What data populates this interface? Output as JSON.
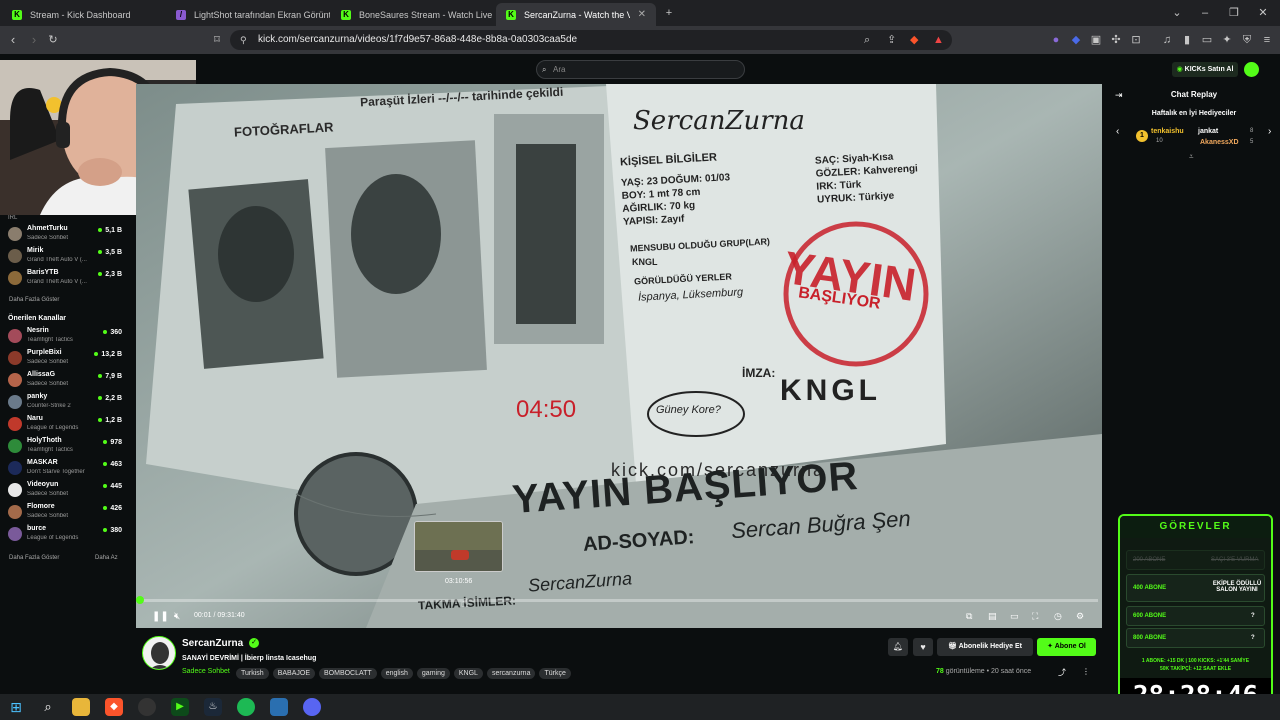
{
  "tabs": [
    {
      "label": "Stream - Kick Dashboard"
    },
    {
      "label": "LightShot tarafından Ekran Görüntüsü"
    },
    {
      "label": "BoneSaures Stream - Watch Live on Kick"
    },
    {
      "label": "SercanZurna - Watch the VOD on Kick"
    }
  ],
  "address": {
    "url": "kick.com/sercanzurna/videos/1f7d9e57-86a8-448e-8b8a-0a0303caa5de"
  },
  "topbar": {
    "search_placeholder": "Ara",
    "kicks_button": "KICKs Satın Al"
  },
  "sidebar": {
    "irl_label": "IRL",
    "followed": [
      {
        "name": "AhmetTurku",
        "game": "Sadece Sohbet",
        "viewers": "5,1 B",
        "color": "#8a7d6d"
      },
      {
        "name": "Mirik",
        "game": "Grand Theft Auto V (...",
        "viewers": "3,5 B",
        "color": "#6b5d4a"
      },
      {
        "name": "BarisYTB",
        "game": "Grand Theft Auto V (...",
        "viewers": "2,3 B",
        "color": "#8c6a3a"
      }
    ],
    "show_more": "Daha Fazla Göster",
    "recommended_title": "Önerilen Kanallar",
    "recommended": [
      {
        "name": "Nesrin",
        "game": "Teamfight Tactics",
        "viewers": "360",
        "color": "#a34b5a"
      },
      {
        "name": "PurpleBixi",
        "game": "Sadece Sohbet",
        "viewers": "13,2 B",
        "color": "#8b3a2a"
      },
      {
        "name": "AllissaG",
        "game": "Sadece Sohbet",
        "viewers": "7,9 B",
        "color": "#b5644a"
      },
      {
        "name": "panky",
        "game": "Counter-Strike 2",
        "viewers": "2,2 B",
        "color": "#6a7a8a"
      },
      {
        "name": "Naru",
        "game": "League of Legends",
        "viewers": "1,2 B",
        "color": "#c0392b"
      },
      {
        "name": "HolyThoth",
        "game": "Teamfight Tactics",
        "viewers": "978",
        "color": "#2e8b3a"
      },
      {
        "name": "MASKAR",
        "game": "Don't Starve Together",
        "viewers": "463",
        "color": "#1c2a5a"
      },
      {
        "name": "Videoyun",
        "game": "Sadece Sohbet",
        "viewers": "445",
        "color": "#e8e8e8"
      },
      {
        "name": "Flomore",
        "game": "Sadece Sohbet",
        "viewers": "426",
        "color": "#a36a4a"
      },
      {
        "name": "burce",
        "game": "League of Legends",
        "viewers": "380",
        "color": "#7a5a9a"
      }
    ],
    "show_more2": "Daha Fazla Göster",
    "show_less": "Daha Az"
  },
  "video": {
    "date_line": "Paraşüt İzleri  --/--/--  tarihinde çekildi",
    "header_left": "FOTOĞRAFLAR",
    "personal_title": "KİŞİSEL BİLGİLER",
    "fields": [
      "YAŞ: 23  DOĞUM: 01/03",
      "BOY: 1 mt 78 cm",
      "AĞIRLIK: 70 kg",
      "YAPISI: Zayıf"
    ],
    "fields_right": [
      "SAÇ: Siyah-Kısa",
      "GÖZLER: Kahverengi",
      "IRK: Türk",
      "UYRUK: Türkiye"
    ],
    "group_title": "MENSUBU OLDUĞU GRUP(LAR)",
    "group_value": "KNGL",
    "seen_title": "GÖRÜLDÜĞÜ YERLER",
    "seen_value": "İspanya, Lüksemburg",
    "stamp_line1": "YAYIN",
    "stamp_line2": "BAŞLIYOR",
    "sign_label": "İMZA:",
    "sign_value": "KNGL",
    "countdown": "04:50",
    "bubble": "Güney Kore?",
    "big_title": "YAYIN BAŞLIYOR",
    "name_label": "AD-SOYAD:",
    "name_value": "Sercan Buğra Şen",
    "nick_label": "TAKMA İSİMLER:",
    "nick_value": "SercanZurna",
    "site": "kick.com/sercanzurna",
    "signature": "SercanZurna",
    "preview_time": "03:10:56",
    "time_current": "00:01",
    "time_total": "09:31:40",
    "progress": 0.0003,
    "hover_fraction": 0.335
  },
  "info": {
    "channel": "SercanZurna",
    "title": "SANAYİ DEVRİMİ | İbierp linsta Icasehug",
    "category": "Sadece Sohbet",
    "tags": [
      "Turkish",
      "BABAJOE",
      "BOMBOCLATT",
      "english",
      "gaming",
      "KNGL",
      "sercanzurna",
      "Türkçe"
    ],
    "views_num": "78",
    "views_label": "görüntüleme",
    "time_ago": "20 saat önce",
    "gift_button": "Abonelik Hediye Et",
    "sub_button": "Abone Ol"
  },
  "chat": {
    "title": "Chat Replay",
    "gifters_title": "Haftalık en İyi Hediyeciler",
    "gifters": [
      {
        "rank": "1",
        "name": "tenkaishu",
        "count": "10"
      },
      {
        "name": "jankat",
        "count": "8"
      },
      {
        "name": "AkanessXD",
        "count": "5"
      }
    ]
  },
  "quests": {
    "title": "GÖREVLER",
    "rows": [
      {
        "goal": "200 ABONE",
        "reward": "SAÇI 3'E VURMA",
        "done": true
      },
      {
        "goal": "400 ABONE",
        "reward": "EKİPLE ÖDÜLLÜ SALON YAYINI",
        "done": false
      },
      {
        "goal": "600 ABONE",
        "reward": "?",
        "done": false
      },
      {
        "goal": "800 ABONE",
        "reward": "?",
        "done": false
      }
    ],
    "footer1": "1 ABONE: +15 DK | 100 KICKS: +1'44 SANİYE",
    "footer2": "50K TAKİPÇİ: +12 SAAT EKLE",
    "timer": "28:28:46"
  },
  "colors": {
    "kick_green": "#53fc18",
    "stamp_red": "#c8202a"
  }
}
